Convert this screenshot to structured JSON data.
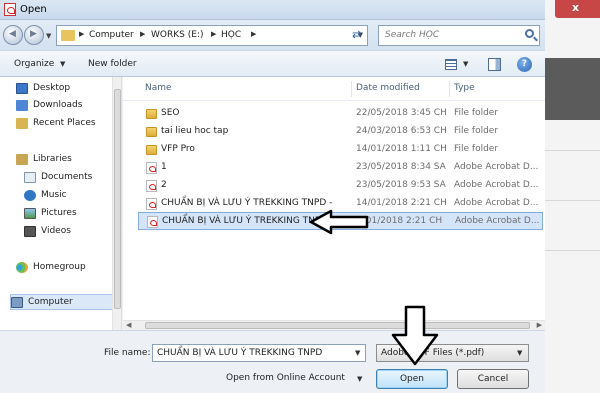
{
  "window": {
    "title": "Open"
  },
  "background_app": {
    "close_glyph": "x"
  },
  "nav": {
    "back_icon": "back-arrow-icon",
    "forward_icon": "forward-arrow-icon",
    "breadcrumbs": [
      "Computer",
      "WORKS (E:)",
      "HỌC"
    ],
    "search_placeholder": "Search HỌC"
  },
  "toolbar": {
    "organize": "Organize",
    "new_folder": "New folder"
  },
  "sidebar": {
    "items": [
      {
        "label": "Desktop",
        "icon": "desktop-icon"
      },
      {
        "label": "Downloads",
        "icon": "downloads-icon"
      },
      {
        "label": "Recent Places",
        "icon": "recent-places-icon"
      },
      {
        "label": "Libraries",
        "icon": "libraries-icon"
      },
      {
        "label": "Documents",
        "icon": "documents-icon"
      },
      {
        "label": "Music",
        "icon": "music-icon"
      },
      {
        "label": "Pictures",
        "icon": "pictures-icon"
      },
      {
        "label": "Videos",
        "icon": "videos-icon"
      },
      {
        "label": "Homegroup",
        "icon": "homegroup-icon"
      },
      {
        "label": "Computer",
        "icon": "computer-icon"
      }
    ]
  },
  "files": {
    "columns": [
      "Name",
      "Date modified",
      "Type"
    ],
    "rows": [
      {
        "name": "SEO",
        "date": "22/05/2018 3:45 CH",
        "type": "File folder",
        "kind": "folder"
      },
      {
        "name": "tai lieu hoc tap",
        "date": "24/03/2018 6:53 CH",
        "type": "File folder",
        "kind": "folder"
      },
      {
        "name": "VFP Pro",
        "date": "14/01/2018 1:11 CH",
        "type": "File folder",
        "kind": "folder"
      },
      {
        "name": "1",
        "date": "23/05/2018 8:34 SA",
        "type": "Adobe Acrobat D...",
        "kind": "pdf"
      },
      {
        "name": "2",
        "date": "23/05/2018 9:53 SA",
        "type": "Adobe Acrobat D...",
        "kind": "pdf"
      },
      {
        "name": "CHUẨN BỊ VÀ LƯU Ý TREKKING TNPD -",
        "date": "14/01/2018 2:21 CH",
        "type": "Adobe Acrobat D...",
        "kind": "pdf"
      },
      {
        "name": "CHUẨN BỊ VÀ LƯU Ý TREKKING TNP",
        "date": "4/01/2018 2:21 CH",
        "type": "Adobe Acrobat D...",
        "kind": "pdf",
        "selected": true
      }
    ]
  },
  "bottom": {
    "file_name_label": "File name:",
    "file_name_value": "CHUẨN BỊ VÀ LƯU Ý TREKKING TNPD",
    "file_type": "Adobe PDF Files (*.pdf)",
    "online_account": "Open from Online Account",
    "open": "Open",
    "cancel": "Cancel"
  }
}
